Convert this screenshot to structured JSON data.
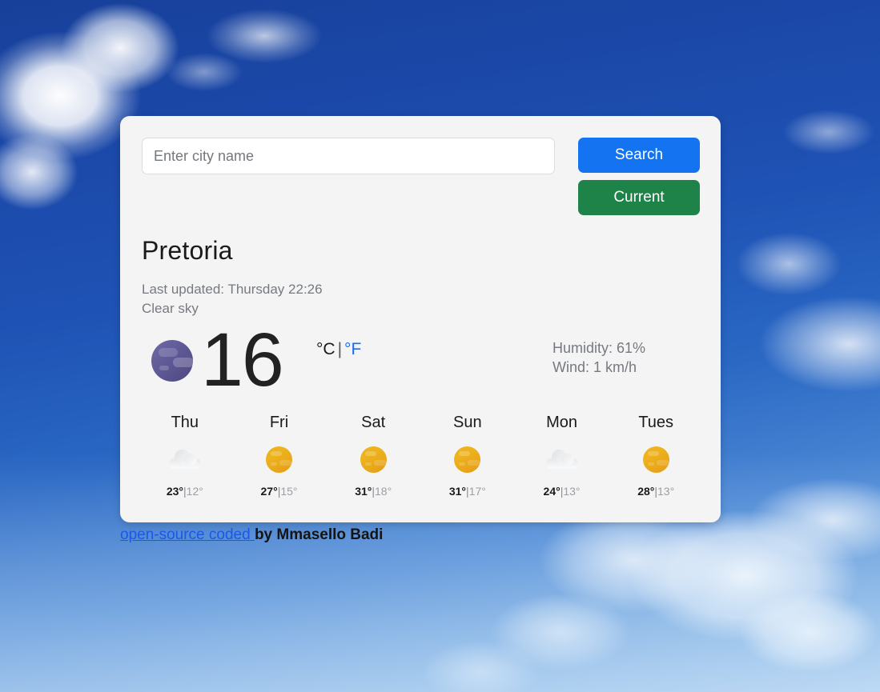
{
  "app": {
    "background": "sky-photo-blue-clouds",
    "card_bg": "#f4f4f4"
  },
  "search": {
    "placeholder": "Enter city name",
    "value": "",
    "search_label": "Search",
    "search_color": "#1473f0",
    "current_label": "Current",
    "current_color": "#1d8349"
  },
  "current": {
    "city": "Pretoria",
    "last_updated": "Last updated: Thursday 22:26",
    "condition": "Clear sky",
    "icon": "moon-clear-icon",
    "temperature": "16",
    "unit_celsius": "°C",
    "unit_separator": "|",
    "unit_fahrenheit": "°F",
    "humidity": "Humidity: 61%",
    "wind": "Wind: 1 km/h"
  },
  "forecast": [
    {
      "day": "Thu",
      "icon": "cloud-icon",
      "high": "23°",
      "sep": "|",
      "low": "12°"
    },
    {
      "day": "Fri",
      "icon": "sun-icon",
      "high": "27°",
      "sep": "|",
      "low": "15°"
    },
    {
      "day": "Sat",
      "icon": "sun-icon",
      "high": "31°",
      "sep": "|",
      "low": "18°"
    },
    {
      "day": "Sun",
      "icon": "sun-icon",
      "high": "31°",
      "sep": "|",
      "low": "17°"
    },
    {
      "day": "Mon",
      "icon": "cloud-icon",
      "high": "24°",
      "sep": "|",
      "low": "13°"
    },
    {
      "day": "Tues",
      "icon": "sun-icon",
      "high": "28°",
      "sep": "|",
      "low": "13°"
    }
  ],
  "footer": {
    "link_text": "open-source coded ",
    "link_color": "#1a58e8",
    "author_text": "by Mmasello Badi"
  }
}
